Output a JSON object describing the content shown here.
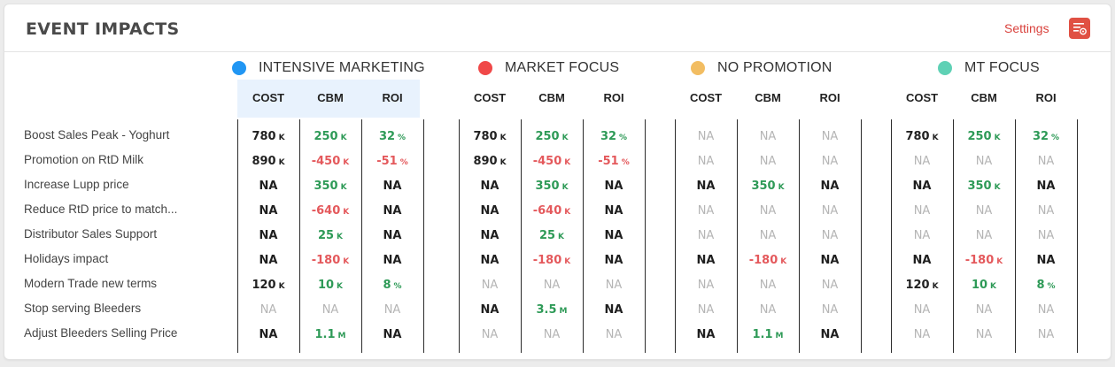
{
  "header": {
    "title": "EVENT IMPACTS",
    "settings_label": "Settings",
    "settings_icon": "settings-list-icon"
  },
  "colors": {
    "accent_red": "#d9423d",
    "positive": "#2e9a57",
    "negative": "#e4595c",
    "highlight": "#e8f2fd"
  },
  "columns": [
    "COST",
    "CBM",
    "ROI"
  ],
  "events": [
    "Boost Sales Peak - Yoghurt",
    "Promotion on RtD Milk",
    "Increase Lupp price",
    "Reduce RtD price to match...",
    "Distributor Sales Support",
    "Holidays impact",
    "Modern Trade new terms",
    "Stop serving Bleeders",
    "Adjust Bleeders Selling Price"
  ],
  "scenarios": [
    {
      "name": "INTENSIVE MARKETING",
      "color": "#2196f3",
      "rows": [
        [
          {
            "v": "780",
            "u": "K",
            "t": "n"
          },
          {
            "v": "250",
            "u": "K",
            "t": "pos"
          },
          {
            "v": "32",
            "u": "%",
            "t": "pos"
          }
        ],
        [
          {
            "v": "890",
            "u": "K",
            "t": "n"
          },
          {
            "v": "-450",
            "u": "K",
            "t": "neg"
          },
          {
            "v": "-51",
            "u": "%",
            "t": "neg"
          }
        ],
        [
          {
            "v": "NA",
            "u": "",
            "t": "na"
          },
          {
            "v": "350",
            "u": "K",
            "t": "pos"
          },
          {
            "v": "NA",
            "u": "",
            "t": "na"
          }
        ],
        [
          {
            "v": "NA",
            "u": "",
            "t": "na"
          },
          {
            "v": "-640",
            "u": "K",
            "t": "neg"
          },
          {
            "v": "NA",
            "u": "",
            "t": "na"
          }
        ],
        [
          {
            "v": "NA",
            "u": "",
            "t": "na"
          },
          {
            "v": "25",
            "u": "K",
            "t": "pos"
          },
          {
            "v": "NA",
            "u": "",
            "t": "na"
          }
        ],
        [
          {
            "v": "NA",
            "u": "",
            "t": "na"
          },
          {
            "v": "-180",
            "u": "K",
            "t": "neg"
          },
          {
            "v": "NA",
            "u": "",
            "t": "na"
          }
        ],
        [
          {
            "v": "120",
            "u": "K",
            "t": "n"
          },
          {
            "v": "10",
            "u": "K",
            "t": "pos"
          },
          {
            "v": "8",
            "u": "%",
            "t": "pos"
          }
        ],
        [
          {
            "v": "NA",
            "u": "",
            "t": "nad"
          },
          {
            "v": "NA",
            "u": "",
            "t": "nad"
          },
          {
            "v": "NA",
            "u": "",
            "t": "nad"
          }
        ],
        [
          {
            "v": "NA",
            "u": "",
            "t": "na"
          },
          {
            "v": "1.1",
            "u": "M",
            "t": "pos"
          },
          {
            "v": "NA",
            "u": "",
            "t": "na"
          }
        ]
      ]
    },
    {
      "name": "MARKET FOCUS",
      "color": "#f04848",
      "rows": [
        [
          {
            "v": "780",
            "u": "K",
            "t": "n"
          },
          {
            "v": "250",
            "u": "K",
            "t": "pos"
          },
          {
            "v": "32",
            "u": "%",
            "t": "pos"
          }
        ],
        [
          {
            "v": "890",
            "u": "K",
            "t": "n"
          },
          {
            "v": "-450",
            "u": "K",
            "t": "neg"
          },
          {
            "v": "-51",
            "u": "%",
            "t": "neg"
          }
        ],
        [
          {
            "v": "NA",
            "u": "",
            "t": "na"
          },
          {
            "v": "350",
            "u": "K",
            "t": "pos"
          },
          {
            "v": "NA",
            "u": "",
            "t": "na"
          }
        ],
        [
          {
            "v": "NA",
            "u": "",
            "t": "na"
          },
          {
            "v": "-640",
            "u": "K",
            "t": "neg"
          },
          {
            "v": "NA",
            "u": "",
            "t": "na"
          }
        ],
        [
          {
            "v": "NA",
            "u": "",
            "t": "na"
          },
          {
            "v": "25",
            "u": "K",
            "t": "pos"
          },
          {
            "v": "NA",
            "u": "",
            "t": "na"
          }
        ],
        [
          {
            "v": "NA",
            "u": "",
            "t": "na"
          },
          {
            "v": "-180",
            "u": "K",
            "t": "neg"
          },
          {
            "v": "NA",
            "u": "",
            "t": "na"
          }
        ],
        [
          {
            "v": "NA",
            "u": "",
            "t": "nad"
          },
          {
            "v": "NA",
            "u": "",
            "t": "nad"
          },
          {
            "v": "NA",
            "u": "",
            "t": "nad"
          }
        ],
        [
          {
            "v": "NA",
            "u": "",
            "t": "na"
          },
          {
            "v": "3.5",
            "u": "M",
            "t": "pos"
          },
          {
            "v": "NA",
            "u": "",
            "t": "na"
          }
        ],
        [
          {
            "v": "NA",
            "u": "",
            "t": "nad"
          },
          {
            "v": "NA",
            "u": "",
            "t": "nad"
          },
          {
            "v": "NA",
            "u": "",
            "t": "nad"
          }
        ]
      ]
    },
    {
      "name": "NO PROMOTION",
      "color": "#f2bd62",
      "rows": [
        [
          {
            "v": "NA",
            "u": "",
            "t": "nad"
          },
          {
            "v": "NA",
            "u": "",
            "t": "nad"
          },
          {
            "v": "NA",
            "u": "",
            "t": "nad"
          }
        ],
        [
          {
            "v": "NA",
            "u": "",
            "t": "nad"
          },
          {
            "v": "NA",
            "u": "",
            "t": "nad"
          },
          {
            "v": "NA",
            "u": "",
            "t": "nad"
          }
        ],
        [
          {
            "v": "NA",
            "u": "",
            "t": "na"
          },
          {
            "v": "350",
            "u": "K",
            "t": "pos"
          },
          {
            "v": "NA",
            "u": "",
            "t": "na"
          }
        ],
        [
          {
            "v": "NA",
            "u": "",
            "t": "nad"
          },
          {
            "v": "NA",
            "u": "",
            "t": "nad"
          },
          {
            "v": "NA",
            "u": "",
            "t": "nad"
          }
        ],
        [
          {
            "v": "NA",
            "u": "",
            "t": "nad"
          },
          {
            "v": "NA",
            "u": "",
            "t": "nad"
          },
          {
            "v": "NA",
            "u": "",
            "t": "nad"
          }
        ],
        [
          {
            "v": "NA",
            "u": "",
            "t": "na"
          },
          {
            "v": "-180",
            "u": "K",
            "t": "neg"
          },
          {
            "v": "NA",
            "u": "",
            "t": "na"
          }
        ],
        [
          {
            "v": "NA",
            "u": "",
            "t": "nad"
          },
          {
            "v": "NA",
            "u": "",
            "t": "nad"
          },
          {
            "v": "NA",
            "u": "",
            "t": "nad"
          }
        ],
        [
          {
            "v": "NA",
            "u": "",
            "t": "nad"
          },
          {
            "v": "NA",
            "u": "",
            "t": "nad"
          },
          {
            "v": "NA",
            "u": "",
            "t": "nad"
          }
        ],
        [
          {
            "v": "NA",
            "u": "",
            "t": "na"
          },
          {
            "v": "1.1",
            "u": "M",
            "t": "pos"
          },
          {
            "v": "NA",
            "u": "",
            "t": "na"
          }
        ]
      ]
    },
    {
      "name": "MT FOCUS",
      "color": "#5fd1b5",
      "rows": [
        [
          {
            "v": "780",
            "u": "K",
            "t": "n"
          },
          {
            "v": "250",
            "u": "K",
            "t": "pos"
          },
          {
            "v": "32",
            "u": "%",
            "t": "pos"
          }
        ],
        [
          {
            "v": "NA",
            "u": "",
            "t": "nad"
          },
          {
            "v": "NA",
            "u": "",
            "t": "nad"
          },
          {
            "v": "NA",
            "u": "",
            "t": "nad"
          }
        ],
        [
          {
            "v": "NA",
            "u": "",
            "t": "na"
          },
          {
            "v": "350",
            "u": "K",
            "t": "pos"
          },
          {
            "v": "NA",
            "u": "",
            "t": "na"
          }
        ],
        [
          {
            "v": "NA",
            "u": "",
            "t": "nad"
          },
          {
            "v": "NA",
            "u": "",
            "t": "nad"
          },
          {
            "v": "NA",
            "u": "",
            "t": "nad"
          }
        ],
        [
          {
            "v": "NA",
            "u": "",
            "t": "nad"
          },
          {
            "v": "NA",
            "u": "",
            "t": "nad"
          },
          {
            "v": "NA",
            "u": "",
            "t": "nad"
          }
        ],
        [
          {
            "v": "NA",
            "u": "",
            "t": "na"
          },
          {
            "v": "-180",
            "u": "K",
            "t": "neg"
          },
          {
            "v": "NA",
            "u": "",
            "t": "na"
          }
        ],
        [
          {
            "v": "120",
            "u": "K",
            "t": "n"
          },
          {
            "v": "10",
            "u": "K",
            "t": "pos"
          },
          {
            "v": "8",
            "u": "%",
            "t": "pos"
          }
        ],
        [
          {
            "v": "NA",
            "u": "",
            "t": "nad"
          },
          {
            "v": "NA",
            "u": "",
            "t": "nad"
          },
          {
            "v": "NA",
            "u": "",
            "t": "nad"
          }
        ],
        [
          {
            "v": "NA",
            "u": "",
            "t": "nad"
          },
          {
            "v": "NA",
            "u": "",
            "t": "nad"
          },
          {
            "v": "NA",
            "u": "",
            "t": "nad"
          }
        ]
      ]
    }
  ]
}
